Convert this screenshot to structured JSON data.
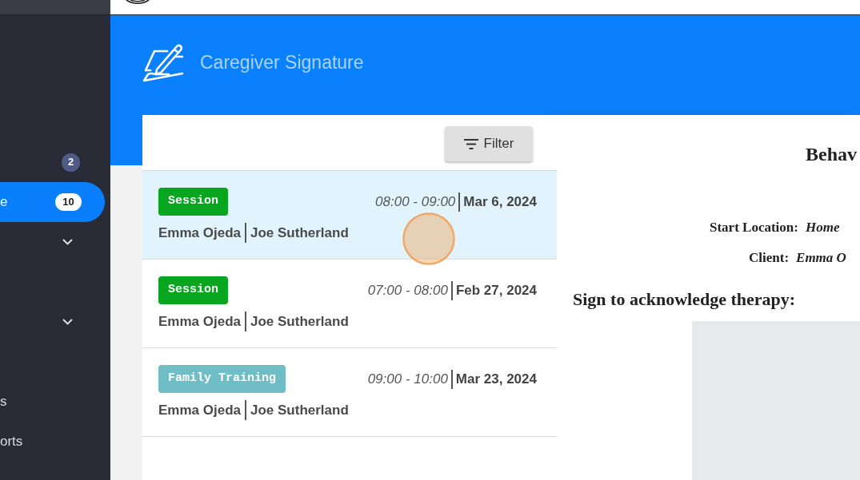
{
  "sidebar": {
    "items": [
      {
        "kind": "link",
        "badge": "2",
        "selected": false
      },
      {
        "kind": "link",
        "label": "e",
        "badge": "10",
        "selected": true
      },
      {
        "kind": "group",
        "expanded": false,
        "selected": false
      },
      {
        "kind": "group",
        "expanded": false,
        "selected": false
      },
      {
        "kind": "link",
        "label": "s",
        "selected": false
      },
      {
        "kind": "link",
        "label": "orts",
        "selected": false
      }
    ]
  },
  "header": {
    "title": "Caregiver Signature"
  },
  "list": {
    "filter_button": "Filter",
    "rows": [
      {
        "tag": "Session",
        "color": "#08a51f",
        "time": "08:00 - 09:00",
        "date": "Mar 6, 2024",
        "client": "Emma Ojeda",
        "caregiver": "Joe Sutherland",
        "selected": true
      },
      {
        "tag": "Session",
        "color": "#08a51f",
        "time": "07:00 - 08:00",
        "date": "Feb 27, 2024",
        "client": "Emma Ojeda",
        "caregiver": "Joe Sutherland",
        "selected": false
      },
      {
        "tag": "Family Training",
        "color": "#6fbdc5",
        "time": "09:00 - 10:00",
        "date": "Mar 23, 2024",
        "client": "Emma Ojeda",
        "caregiver": "Joe Sutherland",
        "selected": false
      }
    ]
  },
  "document": {
    "title": "Behav",
    "fields": [
      {
        "label": "Start Location:",
        "value": "Home"
      },
      {
        "label": "Client:",
        "value": "Emma O"
      }
    ],
    "sign_prompt": "Sign to acknowledge therapy:"
  }
}
